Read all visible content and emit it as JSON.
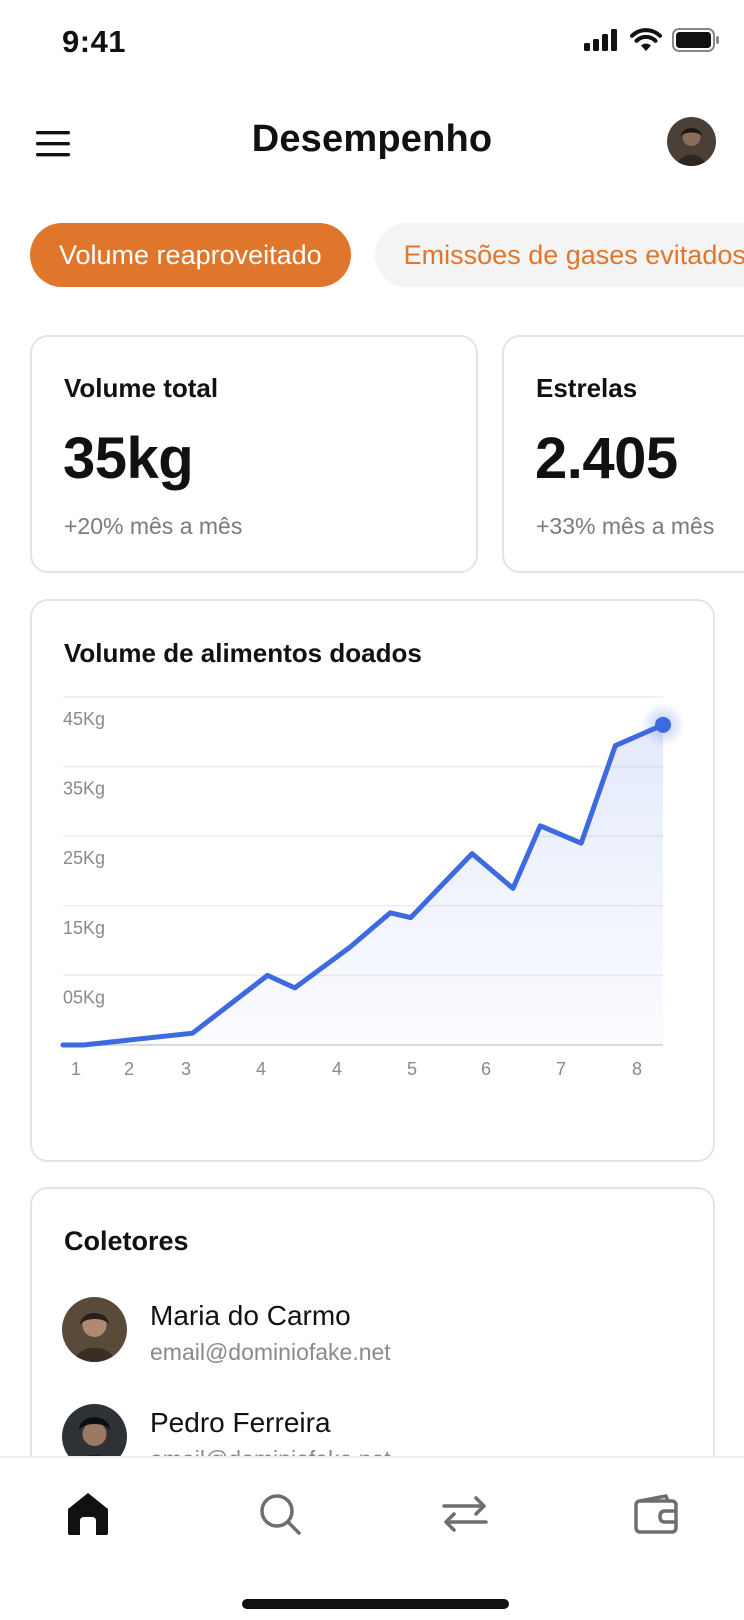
{
  "status_bar": {
    "time": "9:41"
  },
  "header": {
    "title": "Desempenho"
  },
  "tabs": [
    {
      "label": "Volume reaproveitado",
      "active": true
    },
    {
      "label": "Emissões de gases evitados",
      "active": false
    }
  ],
  "stats": [
    {
      "label": "Volume total",
      "value": "35kg",
      "change": "+20% mês a mês"
    },
    {
      "label": "Estrelas",
      "value": "2.405",
      "change": "+33% mês a mês"
    }
  ],
  "colors": {
    "accent": "#E0762C",
    "chart_line": "#3E6AE1"
  },
  "chart_data": {
    "type": "area",
    "title": "Volume de alimentos doados",
    "xlabel": "",
    "ylabel": "",
    "y_tick_labels": [
      "45Kg",
      "35Kg",
      "25Kg",
      "15Kg",
      "05Kg"
    ],
    "x_tick_labels": [
      "1",
      "2",
      "3",
      "4",
      "4",
      "5",
      "6",
      "7",
      "8"
    ],
    "ylim": [
      0,
      50
    ],
    "grid": true,
    "series": [
      {
        "x": [
          1,
          1.3,
          2.9,
          4,
          4.4,
          5.2,
          5.8,
          6.1,
          7,
          7.6,
          8,
          8.6,
          9.1,
          9.8
        ],
        "y": [
          0,
          0,
          1.7,
          10,
          8.2,
          14,
          19,
          18.3,
          27.5,
          22.5,
          31.5,
          29,
          43,
          46
        ]
      }
    ]
  },
  "collectors": {
    "title": "Coletores",
    "items": [
      {
        "name": "Maria do Carmo",
        "email": "email@dominiofake.net"
      },
      {
        "name": "Pedro Ferreira",
        "email": "email@dominiofake.net"
      }
    ]
  },
  "nav": {
    "items": [
      {
        "icon": "home-icon",
        "active": true
      },
      {
        "icon": "search-icon",
        "active": false
      },
      {
        "icon": "transfer-icon",
        "active": false
      },
      {
        "icon": "wallet-icon",
        "active": false
      }
    ]
  }
}
